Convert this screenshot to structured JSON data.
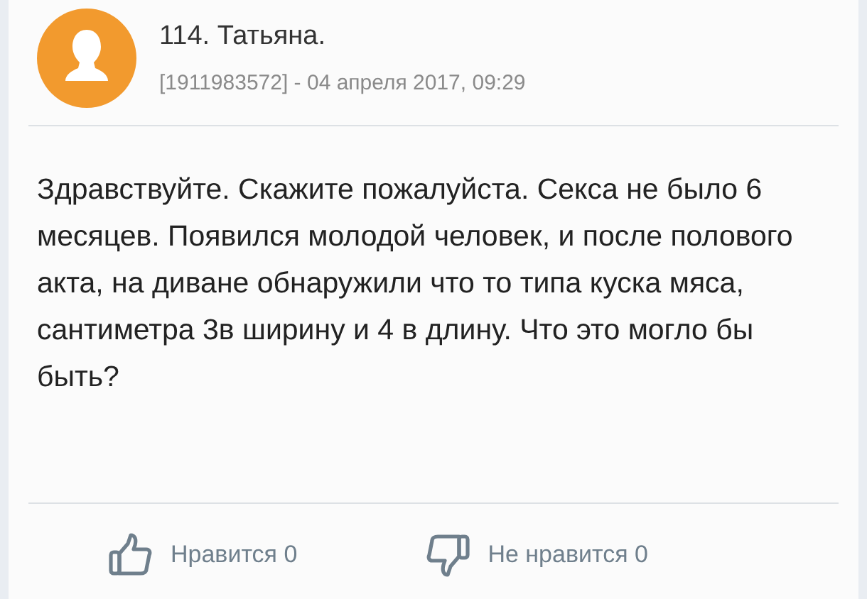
{
  "post": {
    "author": "114. Татьяна.",
    "meta": "[1911983572] - 04 апреля 2017, 09:29",
    "body": "Здравствуйте. Скажите пожалуйста. Секса не было 6 месяцев. Появился молодой человек, и после полового акта, на диване обнаружили что то типа куска мяса, сантиметра 3в ширину и 4 в длину. Что это могло бы быть?"
  },
  "actions": [
    {
      "kind": "like",
      "label": "Нравится 0"
    },
    {
      "kind": "dislike",
      "label": "Не нравится 0"
    }
  ]
}
